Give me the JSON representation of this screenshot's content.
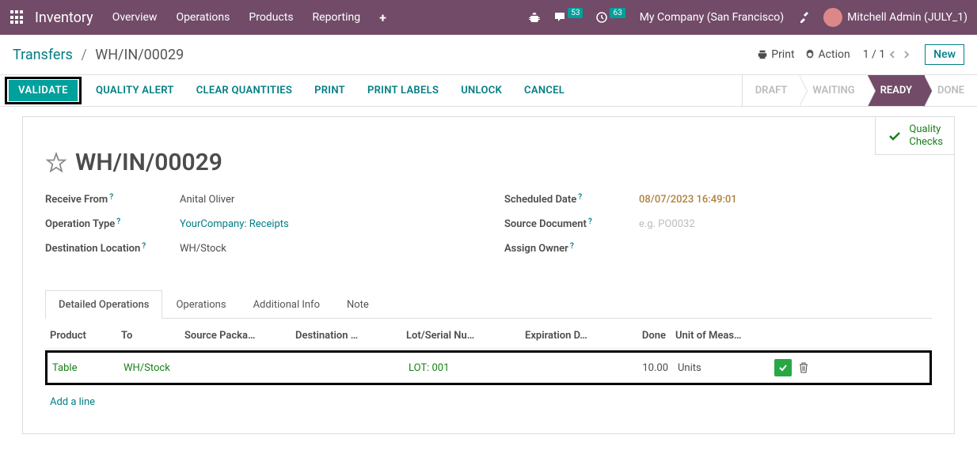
{
  "topbar": {
    "app_name": "Inventory",
    "menu": [
      "Overview",
      "Operations",
      "Products",
      "Reporting"
    ],
    "msg_count": "53",
    "activity_count": "63",
    "company": "My Company (San Francisco)",
    "user": "Mitchell Admin (JULY_1)"
  },
  "breadcrumb": {
    "parent": "Transfers",
    "current": "WH/IN/00029"
  },
  "control": {
    "print": "Print",
    "action": "Action",
    "pager": "1 / 1",
    "new": "New"
  },
  "actions": {
    "validate": "VALIDATE",
    "quality_alert": "QUALITY ALERT",
    "clear_qty": "CLEAR QUANTITIES",
    "print": "PRINT",
    "print_labels": "PRINT LABELS",
    "unlock": "UNLOCK",
    "cancel": "CANCEL"
  },
  "status": {
    "draft": "DRAFT",
    "waiting": "WAITING",
    "ready": "READY",
    "done": "DONE"
  },
  "quality_button": "Quality\nChecks",
  "record": {
    "name": "WH/IN/00029",
    "labels": {
      "receive_from": "Receive From",
      "operation_type": "Operation Type",
      "destination_location": "Destination Location",
      "scheduled_date": "Scheduled Date",
      "source_document": "Source Document",
      "assign_owner": "Assign Owner"
    },
    "values": {
      "receive_from": "Anital Oliver",
      "operation_type": "YourCompany: Receipts",
      "destination_location": "WH/Stock",
      "scheduled_date": "08/07/2023 16:49:01",
      "source_document_placeholder": "e.g. PO0032"
    }
  },
  "tabs": [
    "Detailed Operations",
    "Operations",
    "Additional Info",
    "Note"
  ],
  "table": {
    "headers": {
      "product": "Product",
      "to": "To",
      "source_pkg": "Source Packa…",
      "destination": "Destination …",
      "lot": "Lot/Serial Nu…",
      "expiration": "Expiration D…",
      "done": "Done",
      "uom": "Unit of Meas…"
    },
    "rows": [
      {
        "product": "Table",
        "to": "WH/Stock",
        "source_pkg": "",
        "destination": "",
        "lot": "LOT: 001",
        "expiration": "",
        "done": "10.00",
        "uom": "Units"
      }
    ],
    "add_line": "Add a line"
  }
}
